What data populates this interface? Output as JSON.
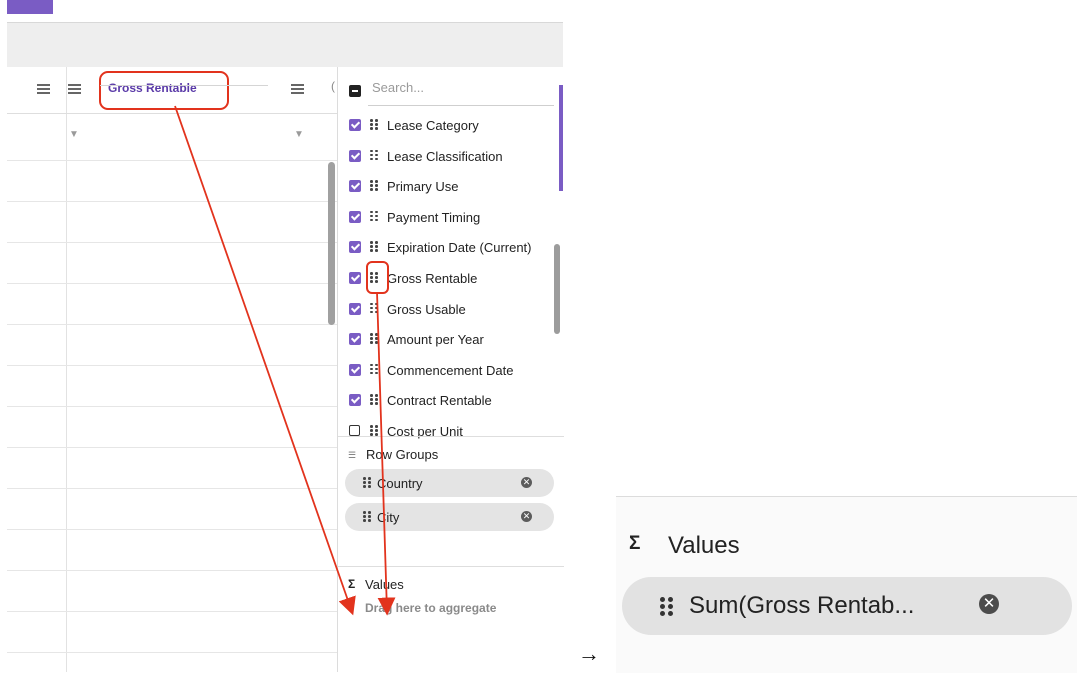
{
  "grid": {
    "header": {
      "selected_column_label": "Gross Rentable",
      "truncated_next_label": "("
    }
  },
  "side_panel": {
    "search_placeholder": "Search...",
    "columns": [
      {
        "label": "Lease Category",
        "checked": true
      },
      {
        "label": "Lease Classification",
        "checked": true
      },
      {
        "label": "Primary Use",
        "checked": true
      },
      {
        "label": "Payment Timing",
        "checked": true
      },
      {
        "label": "Expiration Date (Current)",
        "checked": true
      },
      {
        "label": "Gross Rentable",
        "checked": true,
        "highlighted": true
      },
      {
        "label": "Gross Usable",
        "checked": true
      },
      {
        "label": "Amount per Year",
        "checked": true
      },
      {
        "label": "Commencement Date",
        "checked": true
      },
      {
        "label": "Contract Rentable",
        "checked": true
      },
      {
        "label": "Cost per Unit",
        "checked": false
      }
    ],
    "row_groups": {
      "title": "Row Groups",
      "items": [
        "Country",
        "City"
      ]
    },
    "values": {
      "title": "Values",
      "hint": "Drag here to aggregate"
    }
  },
  "transition_arrow": "→",
  "result": {
    "title": "Values",
    "pill_label": "Sum(Gross Rentab..."
  },
  "colors": {
    "accent_purple": "#7a5cc4",
    "annotation_red": "#e2331d",
    "pill_gray": "#e4e4e4"
  }
}
